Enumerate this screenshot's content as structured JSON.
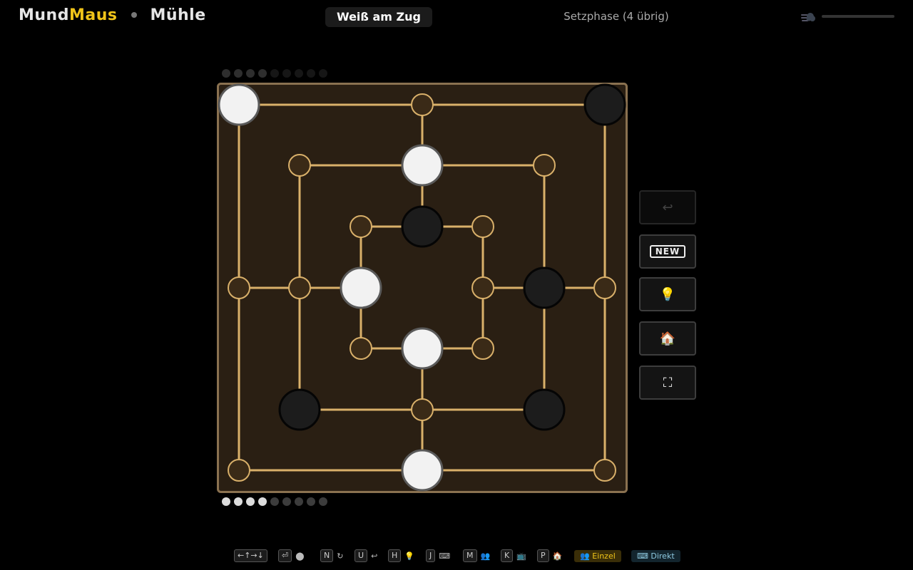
{
  "header": {
    "brand_part1": "Mund",
    "brand_part2": "Maus",
    "game_title": "Mühle",
    "turn_label": "Weiß am Zug",
    "phase_label": "Setzphase (4 übrig)",
    "speed_icon": "wind-icon",
    "speed_level": 0.0
  },
  "colors": {
    "accent": "#f0c419",
    "board_bg": "#2a1f13",
    "board_line": "#d9b06a",
    "board_border": "#8a7150",
    "white_piece": "#f2f2f2",
    "black_piece": "#1c1c1c"
  },
  "reserve": {
    "black_placed": 4,
    "black_total": 9,
    "white_placed": 4,
    "white_total": 9
  },
  "board": {
    "cursor": "a2",
    "points": [
      {
        "id": "a1",
        "piece": "white"
      },
      {
        "id": "d1",
        "piece": "empty"
      },
      {
        "id": "g1",
        "piece": "black"
      },
      {
        "id": "b2",
        "piece": "empty"
      },
      {
        "id": "d2",
        "piece": "white"
      },
      {
        "id": "f2",
        "piece": "empty"
      },
      {
        "id": "c3",
        "piece": "empty"
      },
      {
        "id": "d3",
        "piece": "black"
      },
      {
        "id": "e3",
        "piece": "empty"
      },
      {
        "id": "a4",
        "piece": "empty"
      },
      {
        "id": "b4",
        "piece": "empty"
      },
      {
        "id": "c4",
        "piece": "white"
      },
      {
        "id": "e4",
        "piece": "empty"
      },
      {
        "id": "f4",
        "piece": "black"
      },
      {
        "id": "g4",
        "piece": "empty"
      },
      {
        "id": "c5",
        "piece": "empty"
      },
      {
        "id": "d5",
        "piece": "white"
      },
      {
        "id": "e5",
        "piece": "empty"
      },
      {
        "id": "b6",
        "piece": "black"
      },
      {
        "id": "d6",
        "piece": "empty"
      },
      {
        "id": "f6",
        "piece": "black"
      },
      {
        "id": "a7",
        "piece": "empty"
      },
      {
        "id": "d7",
        "piece": "white"
      },
      {
        "id": "g7",
        "piece": "empty"
      }
    ]
  },
  "side_buttons": [
    {
      "name": "undo-button",
      "icon": "undo-arrow-icon",
      "glyph": "↩",
      "disabled": true
    },
    {
      "name": "new-game-button",
      "icon": "new-badge-icon",
      "label": "NEW",
      "disabled": false
    },
    {
      "name": "hint-button",
      "icon": "lightbulb-icon",
      "glyph": "💡",
      "disabled": false
    },
    {
      "name": "home-button",
      "icon": "home-icon",
      "glyph": "🏠",
      "disabled": false
    },
    {
      "name": "fullscreen-button",
      "icon": "fullscreen-icon",
      "glyph": "⛶",
      "disabled": false
    }
  ],
  "hints": [
    {
      "key": "←↑→↓",
      "label": ""
    },
    {
      "key": "⏎",
      "label": "⬤"
    },
    {
      "key": "N",
      "label": "↻"
    },
    {
      "key": "U",
      "label": "↩"
    },
    {
      "key": "H",
      "label": "💡"
    },
    {
      "key": "J",
      "label": "⌨"
    },
    {
      "key": "M",
      "label": "👥"
    },
    {
      "key": "K",
      "label": "📺"
    },
    {
      "key": "P",
      "label": "🏠"
    }
  ],
  "mode_tags": {
    "player_mode": "👥 Einzel",
    "input_mode": "⌨ Direkt"
  }
}
